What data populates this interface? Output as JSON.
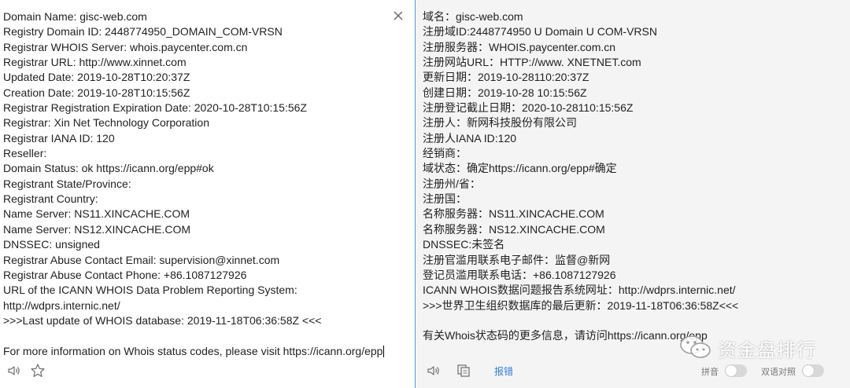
{
  "source": {
    "lines": [
      "Domain Name: gisc-web.com",
      "Registry Domain ID: 2448774950_DOMAIN_COM-VRSN",
      "Registrar WHOIS Server: whois.paycenter.com.cn",
      "Registrar URL: http://www.xinnet.com",
      "Updated Date: 2019-10-28T10:20:37Z",
      "Creation Date: 2019-10-28T10:15:56Z",
      "Registrar Registration Expiration Date: 2020-10-28T10:15:56Z",
      "Registrar: Xin Net Technology Corporation",
      "Registrar IANA ID: 120",
      "Reseller:",
      "Domain Status: ok https://icann.org/epp#ok",
      "Registrant State/Province:",
      "Registrant Country:",
      "Name Server: NS11.XINCACHE.COM",
      "Name Server: NS12.XINCACHE.COM",
      "DNSSEC: unsigned",
      "Registrar Abuse Contact Email: supervision@xinnet.com",
      "Registrar Abuse Contact Phone: +86.1087127926",
      "URL of the ICANN WHOIS Data Problem Reporting System:",
      "http://wdprs.internic.net/",
      ">>>Last update of WHOIS database: 2019-11-18T06:36:58Z <<<",
      "",
      "For more information on Whois status codes, please visit https://icann.org/epp"
    ],
    "close_label": "×"
  },
  "translation": {
    "lines": [
      "域名：gisc-web.com",
      "注册域ID:2448774950 U Domain U COM-VRSN",
      "注册服务器：WHOIS.paycenter.com.cn",
      "注册网站URL：HTTP://www. XNETNET.com",
      "更新日期：2019-10-28110:20:37Z",
      "创建日期：2019-10-28 10:15:56Z",
      "注册登记截止日期：2020-10-28110:15:56Z",
      "注册人：新网科技股份有限公司",
      "注册人IANA ID:120",
      "经销商：",
      "域状态：确定https://icann.org/epp#确定",
      "注册州/省：",
      "注册国：",
      "名称服务器：NS11.XINCACHE.COM",
      "名称服务器：NS12.XINCACHE.COM",
      "DNSSEC:未签名",
      "注册官滥用联系电子邮件：监督@新网",
      "登记员滥用联系电话：+86.1087127926",
      "ICANN WHOIS数据问题报告系统网址：http://wdprs.internic.net/",
      ">>>世界卫生组织数据库的最后更新：2019-11-18T06:36:58Z<<<",
      "",
      "有关Whois状态码的更多信息，请访问https://icann.org/epp"
    ],
    "report_label": "报错",
    "pinyin_label": "拼音",
    "bilingual_label": "双语对照"
  },
  "watermark": {
    "text": "资金盘排行"
  },
  "colors": {
    "divider": "#4a90e2",
    "link": "#2f7de1",
    "right_bg": "#f4f4f4"
  }
}
